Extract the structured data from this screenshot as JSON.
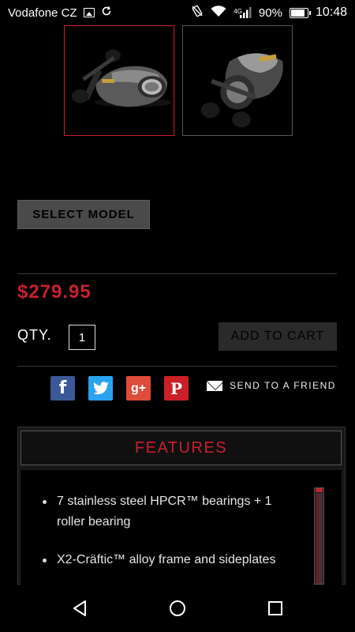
{
  "status_bar": {
    "carrier": "Vodafone CZ",
    "network": "4G",
    "battery": "90%",
    "battery_level": 0.9,
    "time": "10:48"
  },
  "gallery": {
    "thumbnails": [
      {
        "alt": "reel-side-view",
        "selected": true
      },
      {
        "alt": "reel-angle-view",
        "selected": false
      }
    ]
  },
  "product": {
    "select_model_label": "SELECT MODEL",
    "price": "$279.95",
    "qty_label": "QTY.",
    "qty_value": "1",
    "add_to_cart_label": "ADD TO CART"
  },
  "share": {
    "icons": [
      "facebook-icon",
      "twitter-icon",
      "google-plus-icon",
      "pinterest-icon"
    ],
    "facebook_glyph": "f",
    "google_plus_glyph": "g+",
    "pinterest_glyph": "P",
    "send_to_friend_label": "SEND TO A FRIEND"
  },
  "features": {
    "title": "FEATURES",
    "items": [
      "7 stainless steel HPCR™ bearings + 1 roller bearing",
      "X2-Cräftic™ alloy frame and sideplates"
    ]
  },
  "colors": {
    "accent": "#c8202f",
    "background": "#000000",
    "button": "#4a4a4a"
  }
}
